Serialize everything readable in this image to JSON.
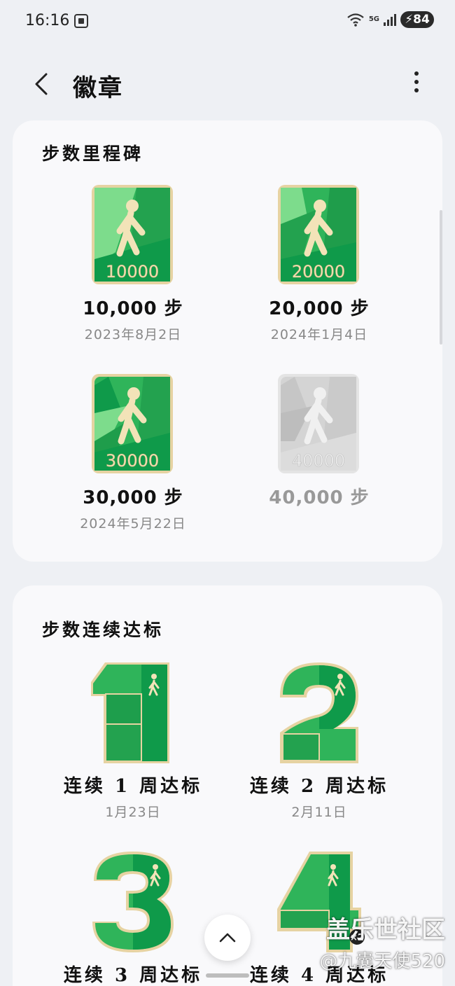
{
  "status_bar": {
    "time": "16:16",
    "network": "5G",
    "battery": "84"
  },
  "header": {
    "title": "徽章",
    "back_icon": "chevron-left-icon",
    "more_icon": "more-vertical-icon"
  },
  "milestones": {
    "title": "步数里程碑",
    "items": [
      {
        "badge_text": "10000",
        "label": "10,000 步",
        "date": "2023年8月2日",
        "unlocked": true
      },
      {
        "badge_text": "20000",
        "label": "20,000 步",
        "date": "2024年1月4日",
        "unlocked": true
      },
      {
        "badge_text": "30000",
        "label": "30,000 步",
        "date": "2024年5月22日",
        "unlocked": true
      },
      {
        "badge_text": "40000",
        "label": "40,000 步",
        "date": "",
        "unlocked": false
      }
    ]
  },
  "streaks": {
    "title": "步数连续达标",
    "items": [
      {
        "digit": "1",
        "label": "连续 1 周达标",
        "date": "1月23日"
      },
      {
        "digit": "2",
        "label": "连续 2 周达标",
        "date": "2月11日"
      },
      {
        "digit": "3",
        "label": "连续 3 周达标",
        "date": ""
      },
      {
        "digit": "4",
        "label": "连续 4 周达标",
        "date": "",
        "count": "×2"
      }
    ]
  },
  "scroll_top_icon": "chevron-up-icon",
  "watermark": {
    "line1": "盖乐世社区",
    "line2": "@九囊天使520"
  },
  "colors": {
    "badge_green": "#2fb45a",
    "badge_dark_green": "#0f9a4a",
    "badge_light_green": "#7ddc8c",
    "gold": "#e6d3a2",
    "locked_gray": "#d8d8d8"
  }
}
